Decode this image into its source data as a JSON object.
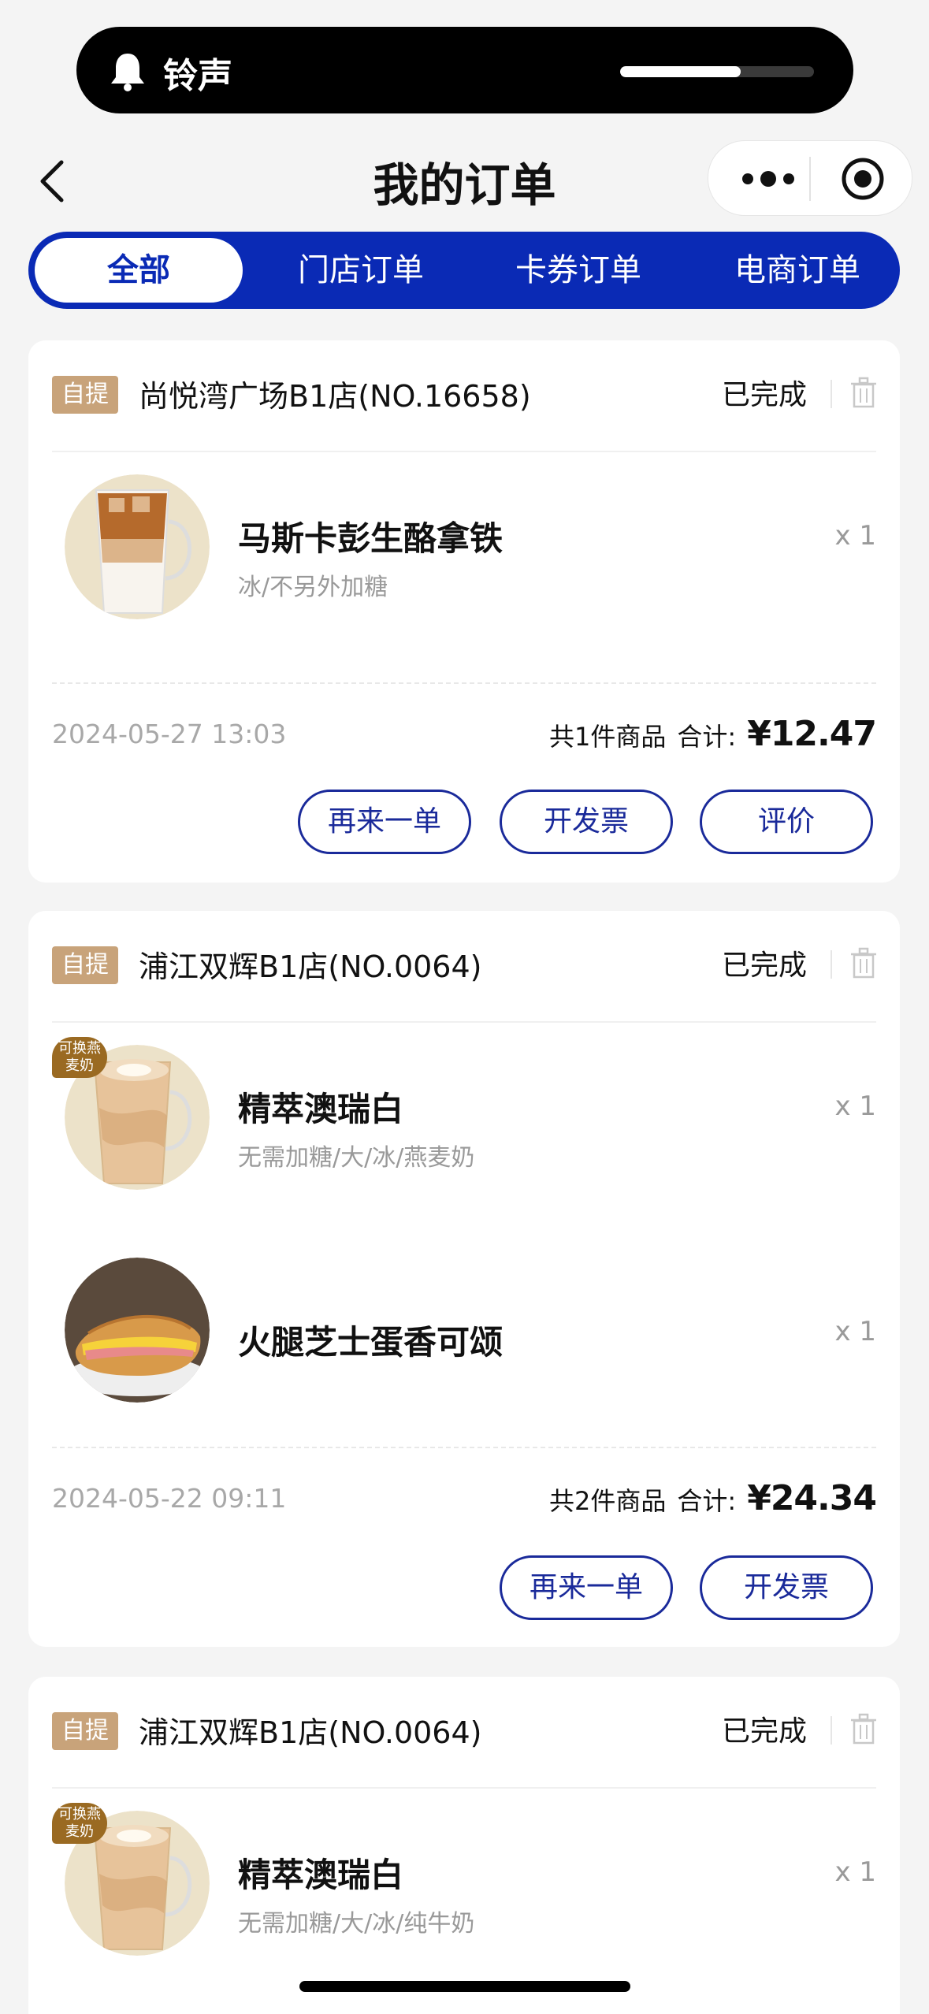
{
  "status_bar": {
    "ringer_label": "铃声",
    "volume_level": 0.62
  },
  "navbar": {
    "title": "我的订单"
  },
  "tabs": [
    {
      "label": "全部",
      "active": true
    },
    {
      "label": "门店订单",
      "active": false
    },
    {
      "label": "卡券订单",
      "active": false
    },
    {
      "label": "电商订单",
      "active": false
    }
  ],
  "orders": [
    {
      "tag": "自提",
      "store": "尚悦湾广场B1店(NO.16658)",
      "status": "已完成",
      "items": [
        {
          "name": "马斯卡彭生酪拿铁",
          "spec": "冰/不另外加糖",
          "qty": "x 1",
          "badge": ""
        }
      ],
      "time": "2024-05-27 13:03",
      "count_text": "共1件商品",
      "total_label": "合计:",
      "total": "¥12.47",
      "buttons": [
        "再来一单",
        "开发票",
        "评价"
      ]
    },
    {
      "tag": "自提",
      "store": "浦江双辉B1店(NO.0064)",
      "status": "已完成",
      "items": [
        {
          "name": "精萃澳瑞白",
          "spec": "无需加糖/大/冰/燕麦奶",
          "qty": "x 1",
          "badge": "可换燕麦奶"
        },
        {
          "name": "火腿芝士蛋香可颂",
          "spec": "",
          "qty": "x 1",
          "badge": ""
        }
      ],
      "time": "2024-05-22 09:11",
      "count_text": "共2件商品",
      "total_label": "合计:",
      "total": "¥24.34",
      "buttons": [
        "再来一单",
        "开发票"
      ]
    },
    {
      "tag": "自提",
      "store": "浦江双辉B1店(NO.0064)",
      "status": "已完成",
      "items": [
        {
          "name": "精萃澳瑞白",
          "spec": "无需加糖/大/冰/纯牛奶",
          "qty": "x 1",
          "badge": "可换燕麦奶"
        }
      ]
    }
  ]
}
